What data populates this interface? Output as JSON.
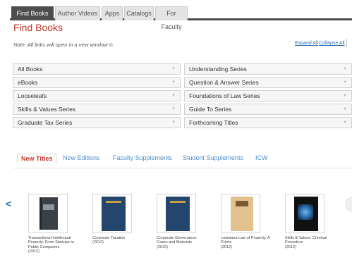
{
  "tabs": [
    {
      "label": "Find Books",
      "active": true
    },
    {
      "label": "Author Videos",
      "active": false
    },
    {
      "label": "Apps",
      "active": false
    },
    {
      "label": "Catalogs",
      "active": false
    },
    {
      "label": "For Faculty",
      "active": false
    }
  ],
  "page": {
    "title": "Find Books",
    "note": "Note: All links will open in a new window",
    "expand_all": "Expand All",
    "collapse_all": "Collapse All"
  },
  "categories": [
    {
      "label": "All Books"
    },
    {
      "label": "Understanding Series"
    },
    {
      "label": "eBooks"
    },
    {
      "label": "Question & Answer Series"
    },
    {
      "label": "Looseleafs"
    },
    {
      "label": "Foundations of Law Series"
    },
    {
      "label": "Skills & Values Series"
    },
    {
      "label": "Guide To Series"
    },
    {
      "label": "Graduate Tax Series"
    },
    {
      "label": "Forthcoming Titles"
    }
  ],
  "subtabs": [
    {
      "label": "New Titles",
      "active": true
    },
    {
      "label": "New Editions",
      "active": false
    },
    {
      "label": "Faculty Supplements",
      "active": false
    },
    {
      "label": "Student Supplements",
      "active": false
    },
    {
      "label": "ICW",
      "active": false
    }
  ],
  "books": [
    {
      "title": "Transactional Intellectual Property: From Startups to Public Companies",
      "year": "(2012)",
      "cover": "binder-dark-icon"
    },
    {
      "title": "Corporate Taxation",
      "year": "(2012)",
      "cover": "blue-book-icon"
    },
    {
      "title": "Corporate Governance: Cases and Materials",
      "year": "(2012)",
      "cover": "blue-book-icon"
    },
    {
      "title": "Louisiana Law of Property, A Précis",
      "year": "(2012)",
      "cover": "tan-book-icon"
    },
    {
      "title": "Skills & Values: Criminal Procedure",
      "year": "(2012)",
      "cover": "skills-values-book-icon"
    }
  ],
  "colors": {
    "accent_red": "#c0392b",
    "link_blue": "#4b8ec9",
    "tab_dark": "#4d4d4d"
  }
}
